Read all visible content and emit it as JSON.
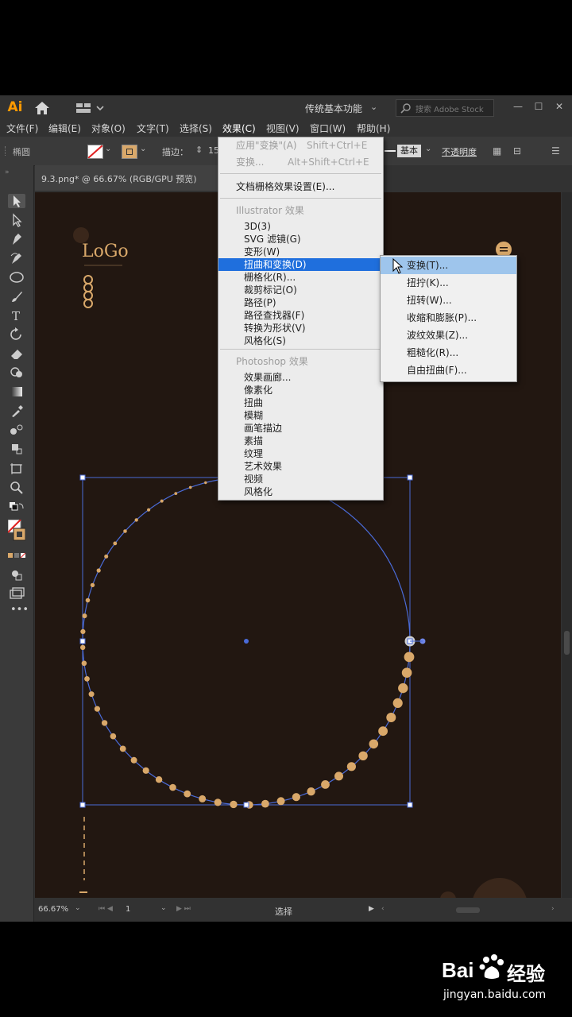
{
  "app": {
    "logo": "Ai",
    "workspace": "传统基本功能",
    "search_placeholder": "搜索 Adobe Stock"
  },
  "menubar": [
    {
      "label": "文件(F)",
      "name": "menu-file"
    },
    {
      "label": "编辑(E)",
      "name": "menu-edit"
    },
    {
      "label": "对象(O)",
      "name": "menu-object"
    },
    {
      "label": "文字(T)",
      "name": "menu-type"
    },
    {
      "label": "选择(S)",
      "name": "menu-select"
    },
    {
      "label": "效果(C)",
      "name": "menu-effect"
    },
    {
      "label": "视图(V)",
      "name": "menu-view"
    },
    {
      "label": "窗口(W)",
      "name": "menu-window"
    },
    {
      "label": "帮助(H)",
      "name": "menu-help"
    }
  ],
  "control": {
    "object_type": "椭圆",
    "stroke_label": "描边：",
    "stroke_value": "15",
    "style_label": "基本",
    "opacity_label": "不透明度"
  },
  "document": {
    "tab_label": "9.3.png* @ 66.67% (RGB/GPU 预览)"
  },
  "effect_menu": {
    "apply": "应用\"变换\"(A)",
    "apply_shortcut": "Shift+Ctrl+E",
    "transform": "变换...",
    "transform_shortcut": "Alt+Shift+Ctrl+E",
    "raster_settings": "文档栅格效果设置(E)...",
    "illustrator_header": "Illustrator 效果",
    "illustrator_items": [
      "3D(3)",
      "SVG 滤镜(G)",
      "变形(W)",
      "扭曲和变换(D)",
      "栅格化(R)...",
      "裁剪标记(O)",
      "路径(P)",
      "路径查找器(F)",
      "转换为形状(V)",
      "风格化(S)"
    ],
    "photoshop_header": "Photoshop 效果",
    "photoshop_items": [
      "效果画廊...",
      "像素化",
      "扭曲",
      "模糊",
      "画笔描边",
      "素描",
      "纹理",
      "艺术效果",
      "视频",
      "风格化"
    ]
  },
  "distort_submenu": [
    "变换(T)...",
    "扭拧(K)...",
    "扭转(W)...",
    "收缩和膨胀(P)...",
    "波纹效果(Z)...",
    "粗糙化(R)...",
    "自由扭曲(F)..."
  ],
  "artwork": {
    "logo_text": "LoGo"
  },
  "status": {
    "zoom": "66.67%",
    "page": "1",
    "mode": "选择"
  },
  "watermark": {
    "brand_left": "Bai",
    "brand_right": "经验",
    "url": "jingyan.baidu.com"
  },
  "colors": {
    "accent_gold": "#d9a86a",
    "selection_blue": "#4a6bd8",
    "menu_highlight": "#1f6fdd",
    "submenu_highlight": "#9ec5ec"
  }
}
